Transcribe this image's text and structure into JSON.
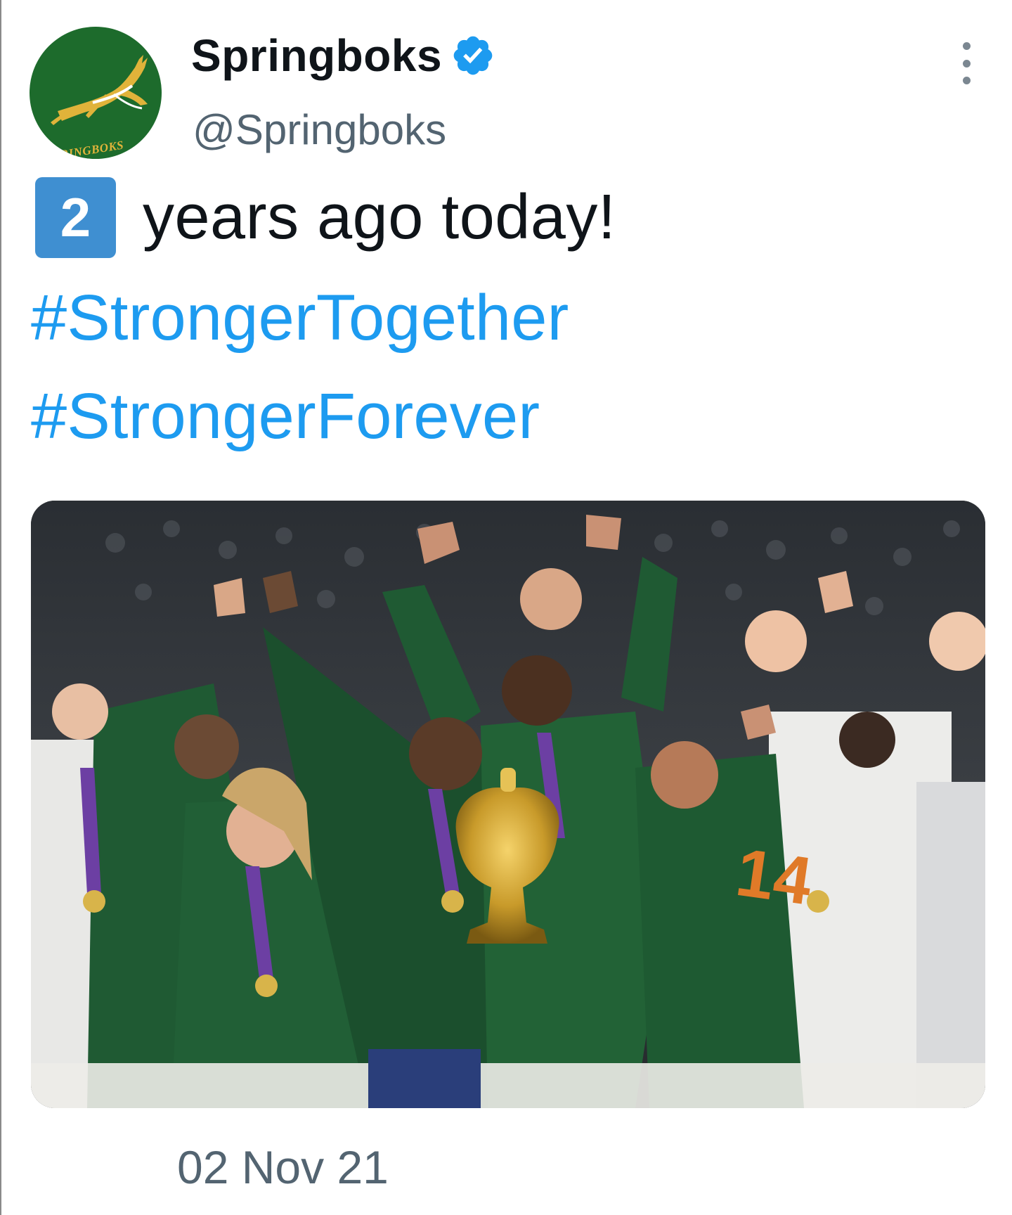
{
  "account": {
    "display_name": "Springboks",
    "handle": "@Springboks",
    "verified": true,
    "avatar_label": "SPRINGBOKS",
    "avatar_icon": "springbok-logo",
    "verified_icon": "verified-badge-icon",
    "more_icon": "more-options-icon"
  },
  "tweet": {
    "keycap_number": "2",
    "text": "years ago today!",
    "hashtags": [
      "#StrongerTogether",
      "#StrongerForever"
    ],
    "timestamp": "02 Nov 21"
  },
  "media": {
    "type": "photo",
    "icon": "photo-image"
  },
  "colors": {
    "hashtag": "#1d9bf0",
    "verified": "#1d9bf0",
    "keycap": "#3f8fd1",
    "avatar_bg": "#1d6b2c",
    "avatar_gold": "#e0b33a",
    "jersey_green": "#1f5a33",
    "text": "#0f1419",
    "secondary_text": "#536471"
  }
}
